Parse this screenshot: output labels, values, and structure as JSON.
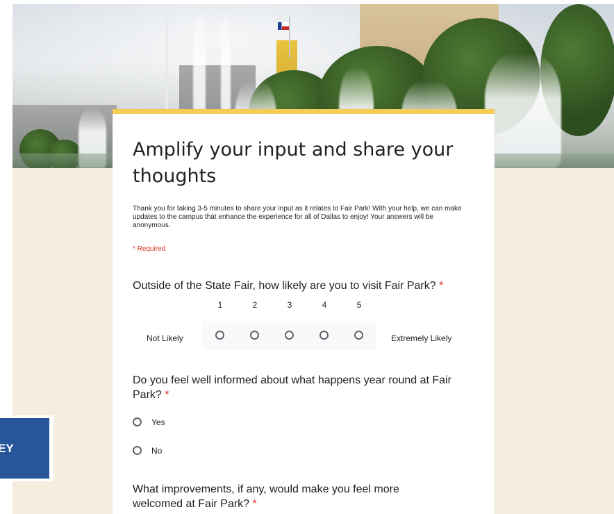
{
  "form": {
    "title": "Amplify your input and share your thoughts",
    "description": "Thank you for taking 3-5 minutes to share your input as it relates to Fair Park! With your help, we can make updates to the campus that enhance the experience for all of Dallas to enjoy! Your answers will be anonymous.",
    "required_note": "* Required",
    "accent_color": "#f5cc56",
    "background_color": "#f5eede"
  },
  "questions": [
    {
      "text": "Outside of the State Fair, how likely are you to visit Fair Park?",
      "required_mark": "*",
      "type": "linear-scale",
      "scale": [
        "1",
        "2",
        "3",
        "4",
        "5"
      ],
      "min_label": "Not Likely",
      "max_label": "Extremely Likely"
    },
    {
      "text": "Do you feel well informed about what happens year round at Fair Park?",
      "required_mark": "*",
      "type": "multiple-choice",
      "options": [
        "Yes",
        "No"
      ]
    },
    {
      "text": "What improvements, if any, would make you feel more welcomed at Fair Park?",
      "required_mark": "*",
      "type": "text"
    }
  ],
  "badge": {
    "text": "EY",
    "color": "#27569a"
  }
}
